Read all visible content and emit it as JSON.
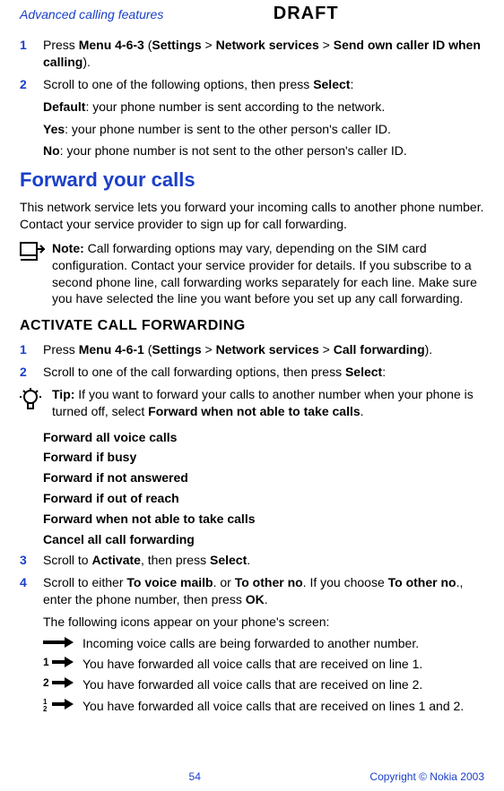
{
  "header": {
    "section": "Advanced calling features",
    "watermark": "DRAFT"
  },
  "block1": {
    "step1_num": "1",
    "step1_text_pre": "Press ",
    "step1_menu": "Menu 4-6-3",
    "step1_paren_open": " (",
    "step1_settings": "Settings",
    "step1_sep1": " > ",
    "step1_net": "Network services",
    "step1_sep2": " > ",
    "step1_send": "Send own caller ID when calling",
    "step1_paren_close": ").",
    "step2_num": "2",
    "step2_text_pre": "Scroll to one of the following options, then press ",
    "step2_select": "Select",
    "step2_colon": ":",
    "opt_default_b": "Default",
    "opt_default_t": ": your phone number is sent according to the network.",
    "opt_yes_b": "Yes",
    "opt_yes_t": ": your phone number is sent to the other person's caller ID.",
    "opt_no_b": "No",
    "opt_no_t": ": your phone number is not sent to the other person's caller ID."
  },
  "h1": "Forward your calls",
  "intro": "This network service lets you forward your incoming calls to another phone number. Contact your service provider to sign up for call forwarding.",
  "note": {
    "label": "Note:",
    "text": " Call forwarding options may vary, depending on the SIM card configuration. Contact your service provider for details. If you subscribe to a second phone line, call forwarding works separately for each line. Make sure you have selected the line you want before you set up any call forwarding."
  },
  "h2": "ACTIVATE CALL FORWARDING",
  "block2": {
    "step1_num": "1",
    "step1_pre": "Press ",
    "step1_menu": "Menu 4-6-1",
    "step1_paren_open": " (",
    "step1_settings": "Settings",
    "step1_sep1": " > ",
    "step1_net": "Network services",
    "step1_sep2": " > ",
    "step1_cf": "Call forwarding",
    "step1_paren_close": ").",
    "step2_num": "2",
    "step2_pre": "Scroll to one of the call forwarding  options, then press ",
    "step2_select": "Select",
    "step2_colon": ":"
  },
  "tip": {
    "label": "Tip:",
    "text1": " If you want to forward your calls to another number when your phone is turned off, select ",
    "bold": "Forward when not able to take calls",
    "text2": "."
  },
  "options": [
    "Forward all voice calls",
    "Forward if busy",
    "Forward if not answered",
    "Forward if out of reach",
    "Forward when not able to take calls",
    "Cancel all call forwarding"
  ],
  "block3": {
    "step3_num": "3",
    "step3_pre": "Scroll to ",
    "step3_activate": "Activate",
    "step3_mid": ", then press ",
    "step3_select": "Select",
    "step3_end": ".",
    "step4_num": "4",
    "step4_pre": "Scroll to either ",
    "step4_b1": "To voice mailb",
    "step4_mid1": ". or ",
    "step4_b2": "To other no",
    "step4_mid2": ". If you choose ",
    "step4_b3": "To other no",
    "step4_mid3": "., enter the phone number, then press ",
    "step4_b4": "OK",
    "step4_end": ".",
    "icons_intro": "The following icons appear on your phone's screen:"
  },
  "icon_rows": [
    "Incoming voice calls are being forwarded to another number.",
    "You have forwarded all voice calls that are received on line 1.",
    "You have forwarded all voice calls that are received on line 2.",
    "You have forwarded all voice calls that are received on lines 1 and 2."
  ],
  "footer": {
    "page": "54",
    "copyright": "Copyright © Nokia 2003"
  }
}
